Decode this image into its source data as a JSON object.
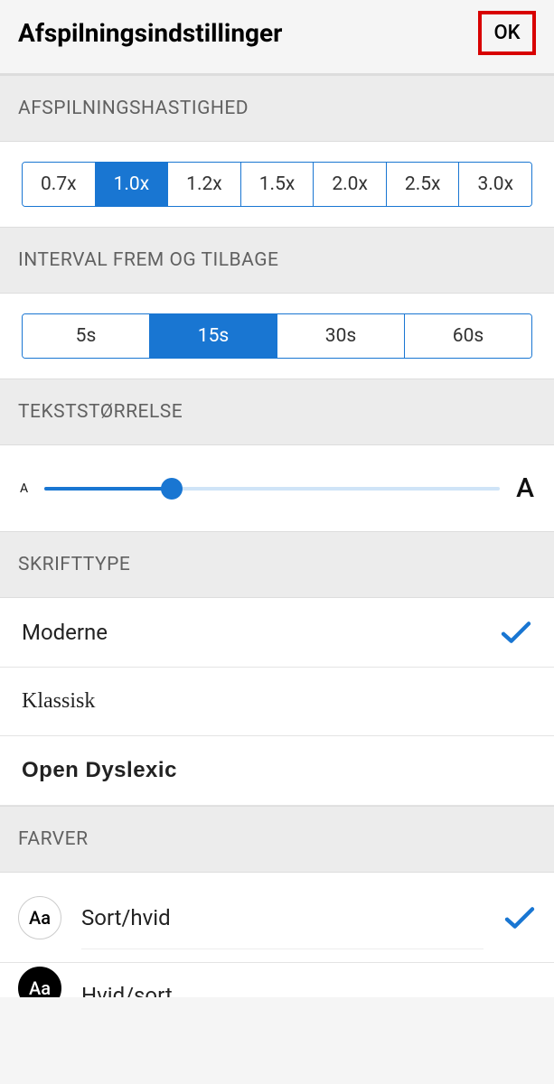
{
  "header": {
    "title": "Afspilningsindstillinger",
    "ok_label": "OK"
  },
  "sections": {
    "speed_heading": "AFSPILNINGSHASTIGHED",
    "interval_heading": "INTERVAL FREM OG TILBAGE",
    "textsize_heading": "TEKSTSTØRRELSE",
    "font_heading": "SKRIFTTYPE",
    "colors_heading": "FARVER"
  },
  "speed": {
    "options": [
      "0.7x",
      "1.0x",
      "1.2x",
      "1.5x",
      "2.0x",
      "2.5x",
      "3.0x"
    ],
    "selected_index": 1
  },
  "interval": {
    "options": [
      "5s",
      "15s",
      "30s",
      "60s"
    ],
    "selected_index": 1
  },
  "textsize": {
    "min_label": "A",
    "max_label": "A",
    "value_percent": 28
  },
  "fonts": {
    "items": [
      {
        "label": "Moderne",
        "style": "modern",
        "selected": true
      },
      {
        "label": "Klassisk",
        "style": "serif",
        "selected": false
      },
      {
        "label": "Open Dyslexic",
        "style": "dyslexic",
        "selected": false
      }
    ]
  },
  "colors": {
    "items": [
      {
        "label": "Sort/hvid",
        "swatch": "light",
        "swatch_text": "Aa",
        "selected": true
      },
      {
        "label": "Hvid/sort",
        "swatch": "dark",
        "swatch_text": "Aa",
        "selected": false
      }
    ]
  }
}
